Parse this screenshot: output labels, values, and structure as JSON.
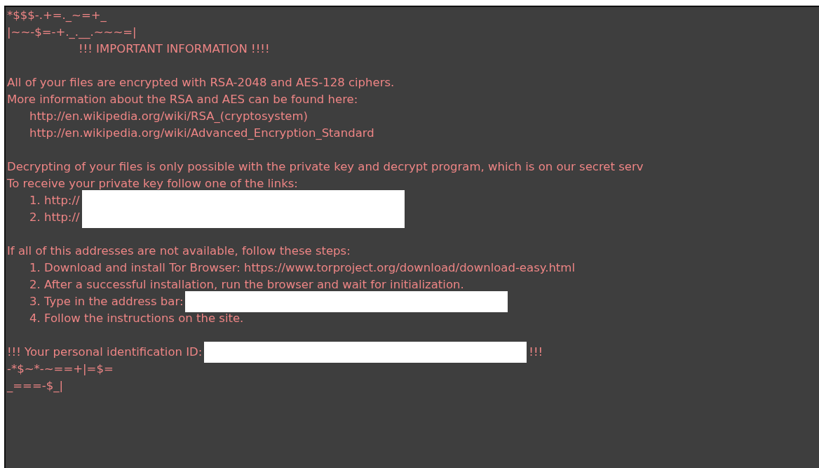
{
  "blocks": [
    {
      "lines": [
        {
          "kind": "plain",
          "text": "*$$$-.+=._~=+_",
          "redacted": false
        },
        {
          "kind": "plain",
          "text": "|~~-$=-+._.__.~~~=|",
          "redacted": false
        },
        {
          "kind": "title",
          "text": "!!! IMPORTANT INFORMATION !!!!",
          "redacted": false
        }
      ]
    },
    {
      "lines": [
        {
          "kind": "plain",
          "text": "All of your files are encrypted with RSA-2048 and AES-128 ciphers.",
          "redacted": false
        },
        {
          "kind": "plain",
          "text": "More information about the RSA and AES can be found here:",
          "redacted": false
        },
        {
          "kind": "item",
          "text": "http://en.wikipedia.org/wiki/RSA_(cryptosystem)",
          "redacted": false
        },
        {
          "kind": "item",
          "text": "http://en.wikipedia.org/wiki/Advanced_Encryption_Standard",
          "redacted": false
        }
      ]
    },
    {
      "lines": [
        {
          "kind": "plain",
          "text": "Decrypting of your files is only possible with the private key and decrypt program, which is on our secret serv",
          "redacted": false
        },
        {
          "kind": "plain",
          "text": "To receive your private key follow one of the links:",
          "redacted": false
        },
        {
          "kind": "item",
          "text": "1. http://",
          "redacted": true
        },
        {
          "kind": "item",
          "text": "2. http://",
          "redacted": true
        }
      ]
    },
    {
      "lines": [
        {
          "kind": "plain",
          "text": "If all of this addresses are not available, follow these steps:",
          "redacted": false
        },
        {
          "kind": "item",
          "text": "1. Download and install Tor Browser: https://www.torproject.org/download/download-easy.html",
          "redacted": false
        },
        {
          "kind": "item",
          "text": "2. After a successful installation, run the browser and wait for initialization.",
          "redacted": false
        },
        {
          "kind": "item",
          "text": "3. Type in the address bar:",
          "redacted": true
        },
        {
          "kind": "item",
          "text": "4. Follow the instructions on the site.",
          "redacted": false
        }
      ]
    },
    {
      "lines": [
        {
          "kind": "plain",
          "text": "!!! Your personal identification ID:",
          "redacted": true,
          "after": "!!!"
        },
        {
          "kind": "plain",
          "text": "-*$~*-~==+|=$=",
          "redacted": false
        },
        {
          "kind": "plain",
          "text": "_===-$_|",
          "redacted": false
        }
      ]
    }
  ]
}
